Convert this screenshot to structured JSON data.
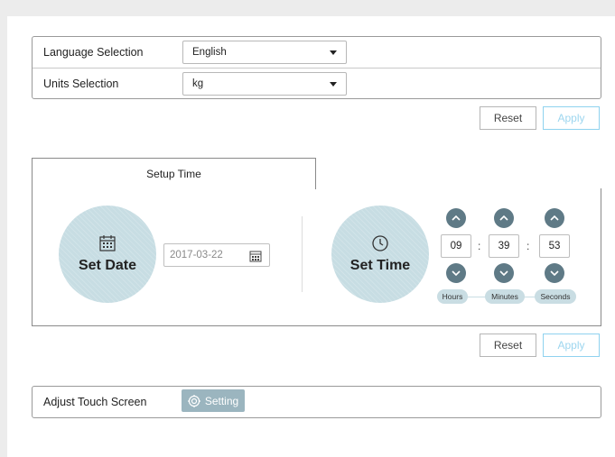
{
  "settings": {
    "language_label": "Language Selection",
    "language_value": "English",
    "units_label": "Units Selection",
    "units_value": "kg"
  },
  "buttons": {
    "reset": "Reset",
    "apply": "Apply"
  },
  "setup_time": {
    "tab_label": "Setup Time",
    "set_date_label": "Set Date",
    "date_value": "2017-03-22",
    "set_time_label": "Set Time",
    "hours": "09",
    "minutes": "39",
    "seconds": "53",
    "hours_label": "Hours",
    "minutes_label": "Minutes",
    "seconds_label": "Seconds",
    "separator": ":"
  },
  "touch": {
    "label": "Adjust Touch Screen",
    "button": "Setting"
  },
  "colors": {
    "accent": "#8fd2ef",
    "circle": "#c7dde3",
    "arrow": "#5f7a86",
    "setting_button": "#9bb5bf"
  }
}
